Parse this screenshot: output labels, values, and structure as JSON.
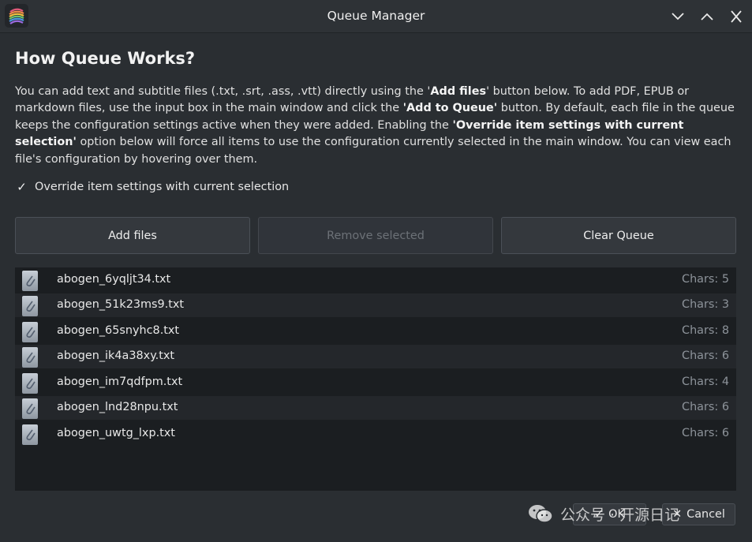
{
  "window": {
    "title": "Queue Manager"
  },
  "heading": "How Queue Works?",
  "description": {
    "p1": "You can add text and subtitle files (.txt, .srt, .ass, .vtt) directly using the '",
    "b1": "Add files",
    "p2": "' button below. To add PDF, EPUB or markdown files, use the input box in the main window and click the ",
    "b2": "'Add to Queue'",
    "p3": " button. By default, each file in the queue keeps the configuration settings active when they were added. Enabling the ",
    "b3": "'Override item settings with current selection'",
    "p4": " option below will force all items to use the configuration currently selected in the main window. You can view each file's configuration by hovering over them."
  },
  "override": {
    "checked": true,
    "check_glyph": "✓",
    "label": "Override item settings with current selection"
  },
  "buttons": {
    "add": "Add files",
    "remove": "Remove selected",
    "clear": "Clear Queue"
  },
  "queue": [
    {
      "name": "abogen_6yqljt34.txt",
      "chars": "Chars: 5"
    },
    {
      "name": "abogen_51k23ms9.txt",
      "chars": "Chars: 3"
    },
    {
      "name": "abogen_65snyhc8.txt",
      "chars": "Chars: 8"
    },
    {
      "name": "abogen_ik4a38xy.txt",
      "chars": "Chars: 6"
    },
    {
      "name": "abogen_im7qdfpm.txt",
      "chars": "Chars: 4"
    },
    {
      "name": "abogen_lnd28npu.txt",
      "chars": "Chars: 6"
    },
    {
      "name": "abogen_uwtg_lxp.txt",
      "chars": "Chars: 6"
    }
  ],
  "footer": {
    "ok": "OK",
    "cancel": "Cancel",
    "ok_icon": "✓",
    "cancel_icon": "✕"
  },
  "watermark": "公众号 · 开源日记",
  "icons": {
    "app": "app-logo-icon",
    "minimize": "chevron-down-icon",
    "maximize": "chevron-up-icon",
    "close": "close-icon",
    "file": "paperclip-icon"
  },
  "colors": {
    "background": "#2a2e32",
    "list_background": "#1b1e21",
    "button": "#34383d"
  }
}
